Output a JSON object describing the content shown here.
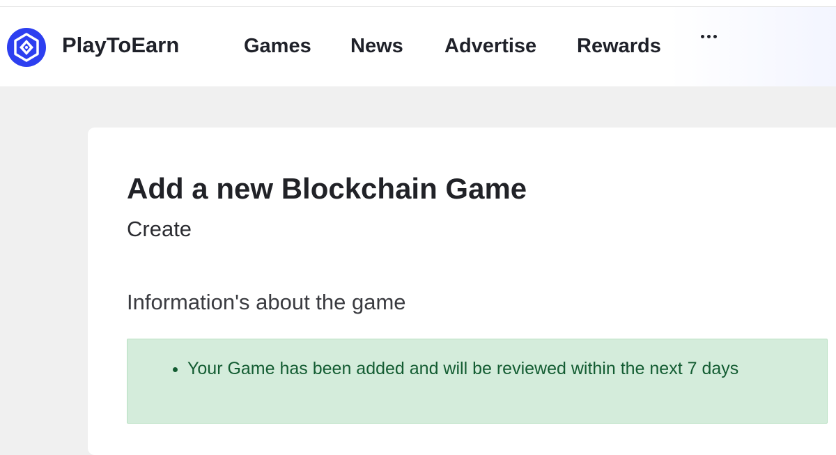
{
  "brand": {
    "name": "PlayToEarn",
    "accent": "#2d3ff0"
  },
  "nav": {
    "items": [
      "Games",
      "News",
      "Advertise",
      "Rewards"
    ],
    "more_icon": "ellipsis-icon"
  },
  "page": {
    "title": "Add a new Blockchain Game",
    "subtitle": "Create",
    "section_heading": "Information's about the game"
  },
  "alert": {
    "type": "success",
    "messages": [
      "Your Game has been added and will be reviewed within the next 7 days"
    ],
    "background": "#d4ecdb",
    "text_color": "#135c32"
  }
}
